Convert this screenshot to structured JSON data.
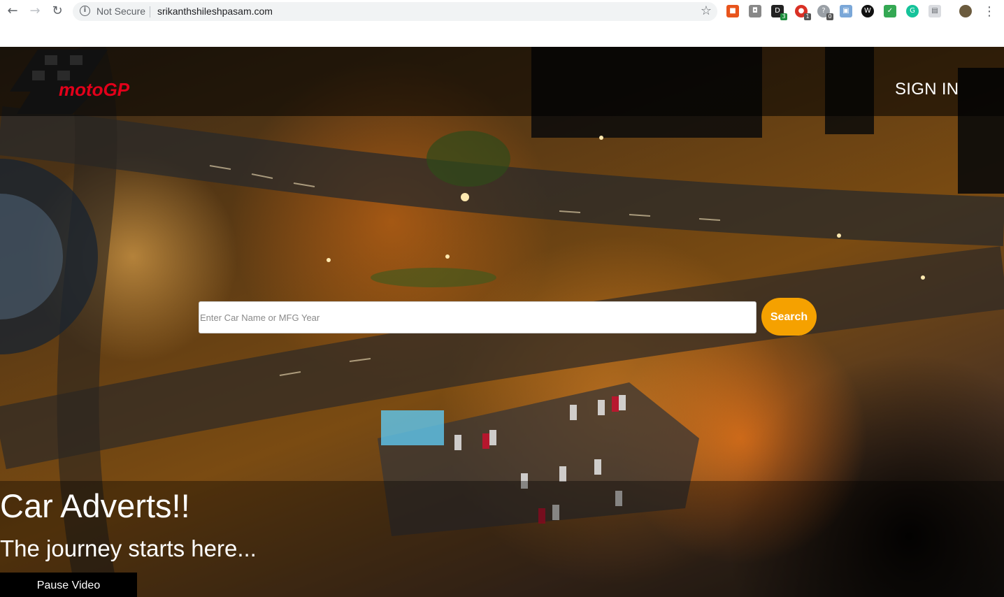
{
  "browser": {
    "not_secure_label": "Not Secure",
    "url": "srikanthshileshpasam.com",
    "extension_badges": [
      "3",
      "1",
      "0"
    ]
  },
  "header": {
    "logo_text": "motoGP",
    "sign_in_label": "SIGN IN"
  },
  "search": {
    "placeholder": "Enter Car Name or MFG Year",
    "value": "",
    "button_label": "Search"
  },
  "hero": {
    "headline": "Car Adverts!!",
    "tagline": "The journey starts here...",
    "pause_label": "Pause Video"
  },
  "colors": {
    "search_button": "#f5a100",
    "logo_red": "#e2001a"
  }
}
